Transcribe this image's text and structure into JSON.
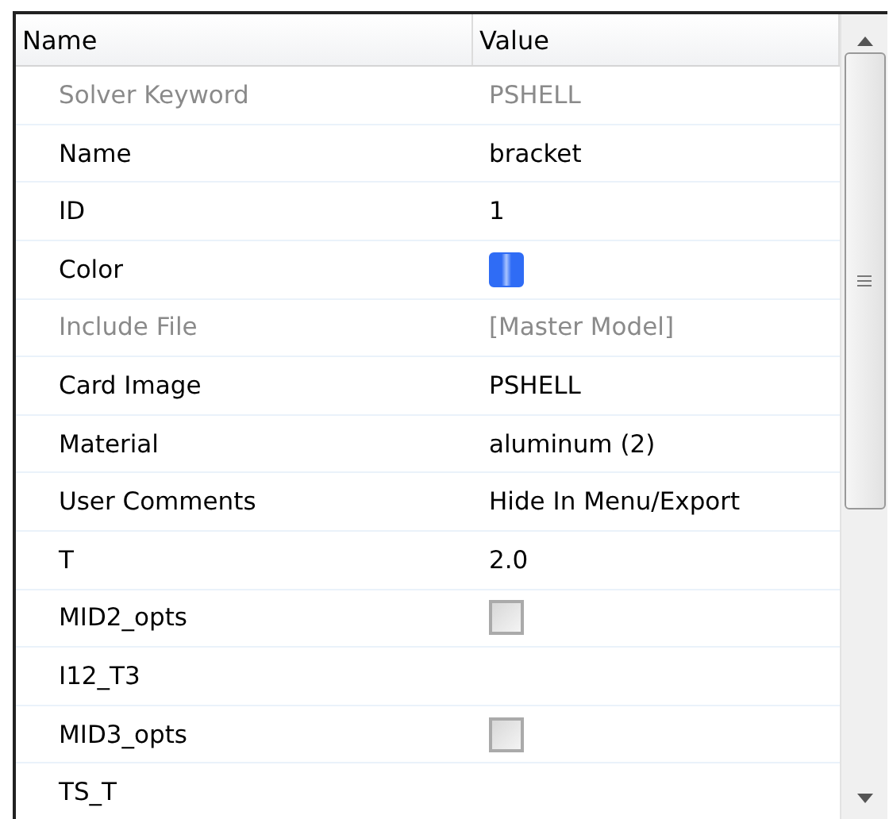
{
  "columns": [
    "Name",
    "Value"
  ],
  "rows": [
    {
      "name": "Solver Keyword",
      "kind": "text",
      "value": "PSHELL",
      "disabled": true
    },
    {
      "name": "Name",
      "kind": "text",
      "value": "bracket",
      "disabled": false
    },
    {
      "name": "ID",
      "kind": "text",
      "value": "1",
      "disabled": false
    },
    {
      "name": "Color",
      "kind": "color",
      "color": "#2f6cf5",
      "disabled": false
    },
    {
      "name": "Include File",
      "kind": "text",
      "value": "[Master Model]",
      "disabled": true
    },
    {
      "name": "Card Image",
      "kind": "text",
      "value": "PSHELL",
      "disabled": false
    },
    {
      "name": "Material",
      "kind": "text",
      "value": "aluminum (2)",
      "disabled": false
    },
    {
      "name": "User Comments",
      "kind": "text",
      "value": "Hide In Menu/Export",
      "disabled": false
    },
    {
      "name": "T",
      "kind": "text",
      "value": "2.0",
      "disabled": false
    },
    {
      "name": "MID2_opts",
      "kind": "checkbox",
      "checked": false,
      "disabled": false
    },
    {
      "name": "I12_T3",
      "kind": "empty",
      "disabled": false
    },
    {
      "name": "MID3_opts",
      "kind": "checkbox",
      "checked": false,
      "disabled": false
    },
    {
      "name": "TS_T",
      "kind": "empty",
      "disabled": false
    }
  ]
}
